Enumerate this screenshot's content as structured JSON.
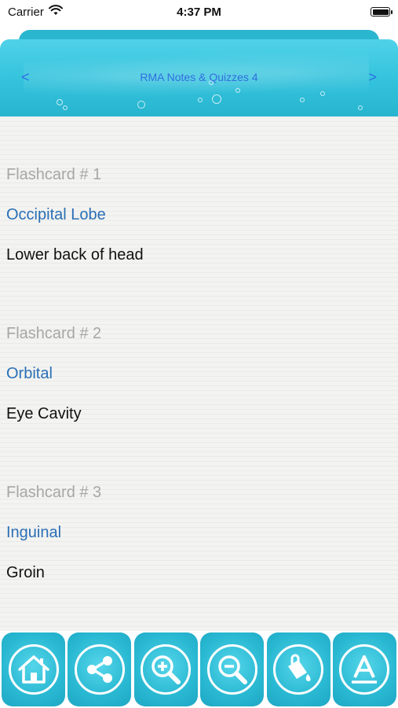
{
  "status": {
    "carrier": "Carrier",
    "time": "4:37 PM"
  },
  "header": {
    "title": "RMA Notes & Quizzes 4",
    "prev_label": "<",
    "next_label": ">"
  },
  "flashcards": [
    {
      "number": "Flashcard # 1",
      "term": "Occipital Lobe",
      "definition": "Lower back of head"
    },
    {
      "number": "Flashcard # 2",
      "term": "Orbital",
      "definition": "Eye Cavity"
    },
    {
      "number": "Flashcard # 3",
      "term": "Inguinal",
      "definition": "Groin"
    }
  ],
  "toolbar": {
    "buttons": [
      "home-icon",
      "share-icon",
      "zoom-in-icon",
      "zoom-out-icon",
      "paint-bucket-icon",
      "font-icon"
    ]
  },
  "colors": {
    "accent": "#29b8d2",
    "term": "#2a6fb6",
    "title": "#2f6fe0",
    "muted": "#a7a7a7"
  }
}
